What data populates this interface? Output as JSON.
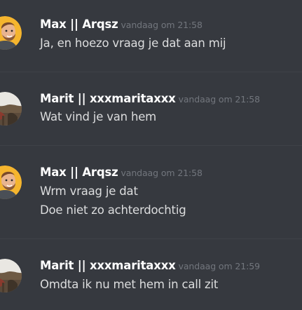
{
  "messages": [
    {
      "user": "Max || Arqsz",
      "time": "vandaag om 21:58",
      "lines": [
        "Ja, en hoezo vraag je dat aan mij"
      ],
      "avatar": "cartoon-man-avatar"
    },
    {
      "user": "Marit || xxxmaritaxxx",
      "time": "vandaag om 21:58",
      "lines": [
        "Wat vind je van hem"
      ],
      "avatar": "landscape-photo-avatar"
    },
    {
      "user": "Max || Arqsz",
      "time": "vandaag om 21:58",
      "lines": [
        "Wrm vraag je dat",
        "Doe niet zo achterdochtig"
      ],
      "avatar": "cartoon-man-avatar"
    },
    {
      "user": "Marit || xxxmaritaxxx",
      "time": "vandaag om 21:59",
      "lines": [
        "Omdta ik nu met hem in call zit"
      ],
      "avatar": "landscape-photo-avatar"
    }
  ],
  "colors": {
    "background": "#36393f",
    "username": "#ffffff",
    "message_text": "#dcddde",
    "timestamp": "#72767d",
    "divider": "#3f4248",
    "cartoon_avatar_bg": "#f5b52e"
  }
}
